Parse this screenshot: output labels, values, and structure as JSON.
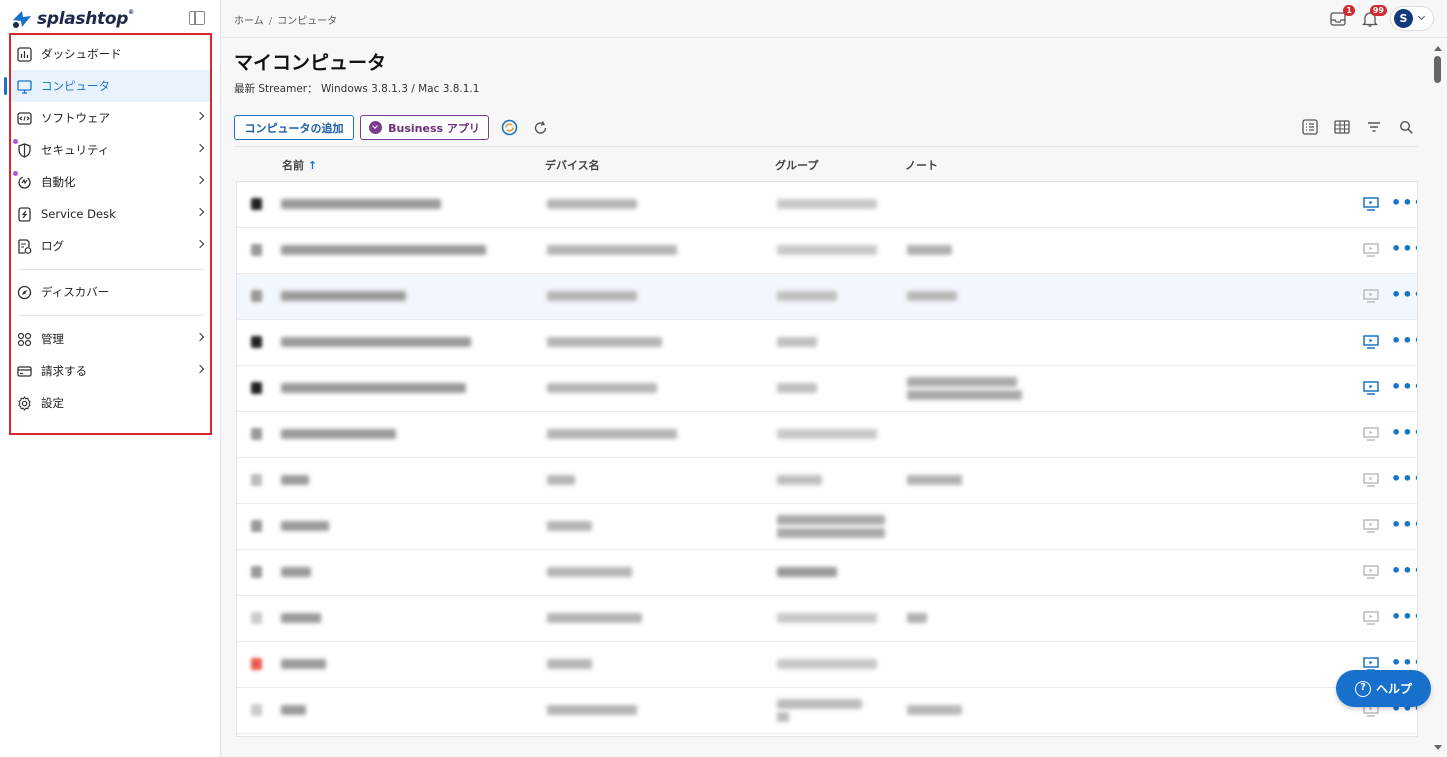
{
  "brand": {
    "name": "splashtop",
    "trademark": "®"
  },
  "breadcrumb": {
    "home": "ホーム",
    "current": "コンピュータ"
  },
  "badges": {
    "inbox": "1",
    "notifications": "99"
  },
  "user": {
    "initial": "S"
  },
  "sidebar": {
    "items": [
      {
        "label": "ダッシュボード",
        "icon": "dashboard-icon"
      },
      {
        "label": "コンピュータ",
        "icon": "monitor-icon",
        "active": true
      },
      {
        "label": "ソフトウェア",
        "icon": "code-icon"
      },
      {
        "label": "セキュリティ",
        "icon": "shield-icon"
      },
      {
        "label": "自動化",
        "icon": "automation-icon"
      },
      {
        "label": "Service Desk",
        "icon": "service-desk-icon"
      },
      {
        "label": "ログ",
        "icon": "log-icon"
      },
      {
        "label": "ディスカバー",
        "icon": "compass-icon"
      },
      {
        "label": "管理",
        "icon": "grid-icon"
      },
      {
        "label": "請求する",
        "icon": "card-icon"
      },
      {
        "label": "設定",
        "icon": "gear-icon"
      }
    ]
  },
  "main": {
    "title": "マイコンピュータ",
    "subtitle": "最新 Streamer： Windows 3.8.1.3 / Mac 3.8.1.1",
    "add_button": "コンピュータの追加",
    "business_button": "Business アプリ",
    "columns": {
      "name": "名前",
      "device": "デバイス名",
      "group": "グループ",
      "note": "ノート"
    }
  },
  "help": {
    "label": "ヘルプ"
  },
  "colors": {
    "accent": "#1a73c8",
    "highlight": "#d32a2f",
    "business": "#7b3e8c"
  }
}
